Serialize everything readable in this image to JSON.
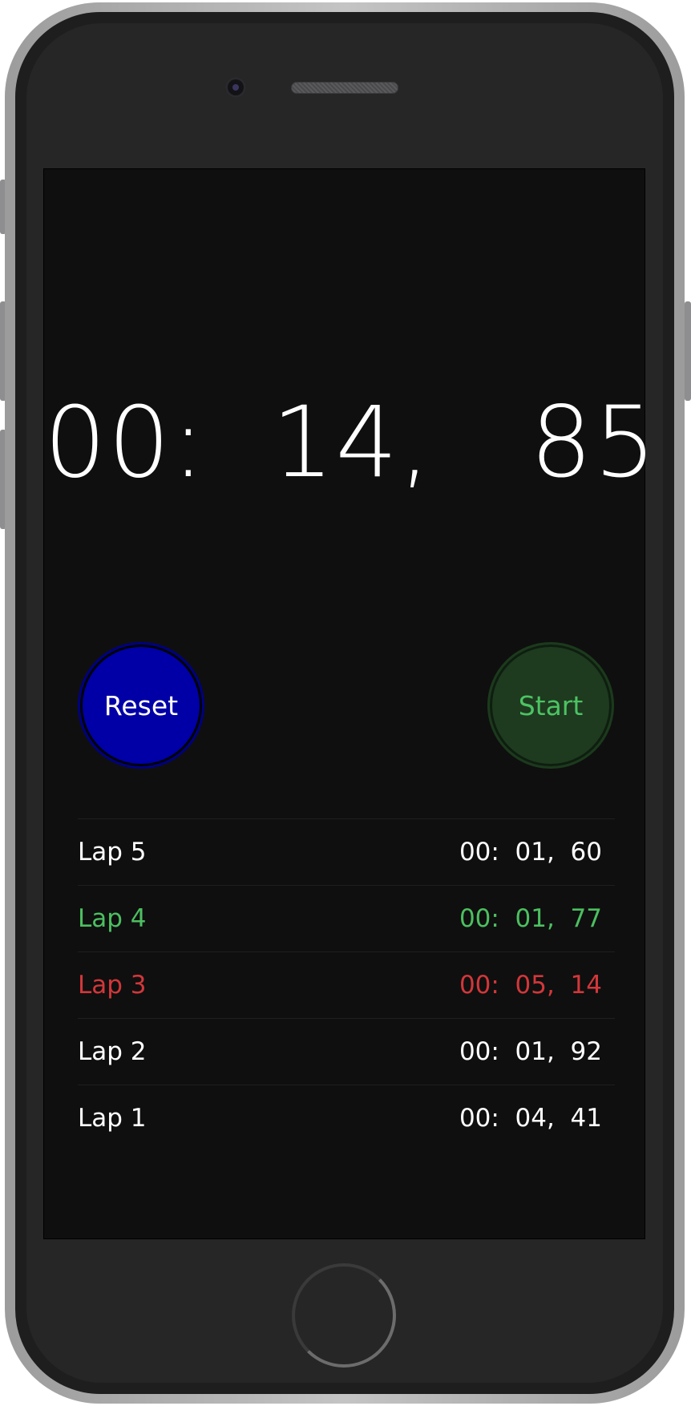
{
  "stopwatch": {
    "time": "00:  14,   85"
  },
  "controls": {
    "reset_label": "Reset",
    "start_label": "Start"
  },
  "laps": [
    {
      "label": "Lap 5",
      "time": "00:  01,  60",
      "status": "normal"
    },
    {
      "label": "Lap 4",
      "time": "00:  01,  77",
      "status": "best"
    },
    {
      "label": "Lap 3",
      "time": "00:  05,  14",
      "status": "worst"
    },
    {
      "label": "Lap 2",
      "time": "00:  01,  92",
      "status": "normal"
    },
    {
      "label": "Lap 1",
      "time": "00:  04,  41",
      "status": "normal"
    }
  ],
  "colors": {
    "background": "#0f0f0f",
    "reset_button": "#0000a6",
    "start_button": "#1e3a1f",
    "start_text": "#4cc363",
    "best_lap": "#4cbf60",
    "worst_lap": "#d2373a"
  }
}
